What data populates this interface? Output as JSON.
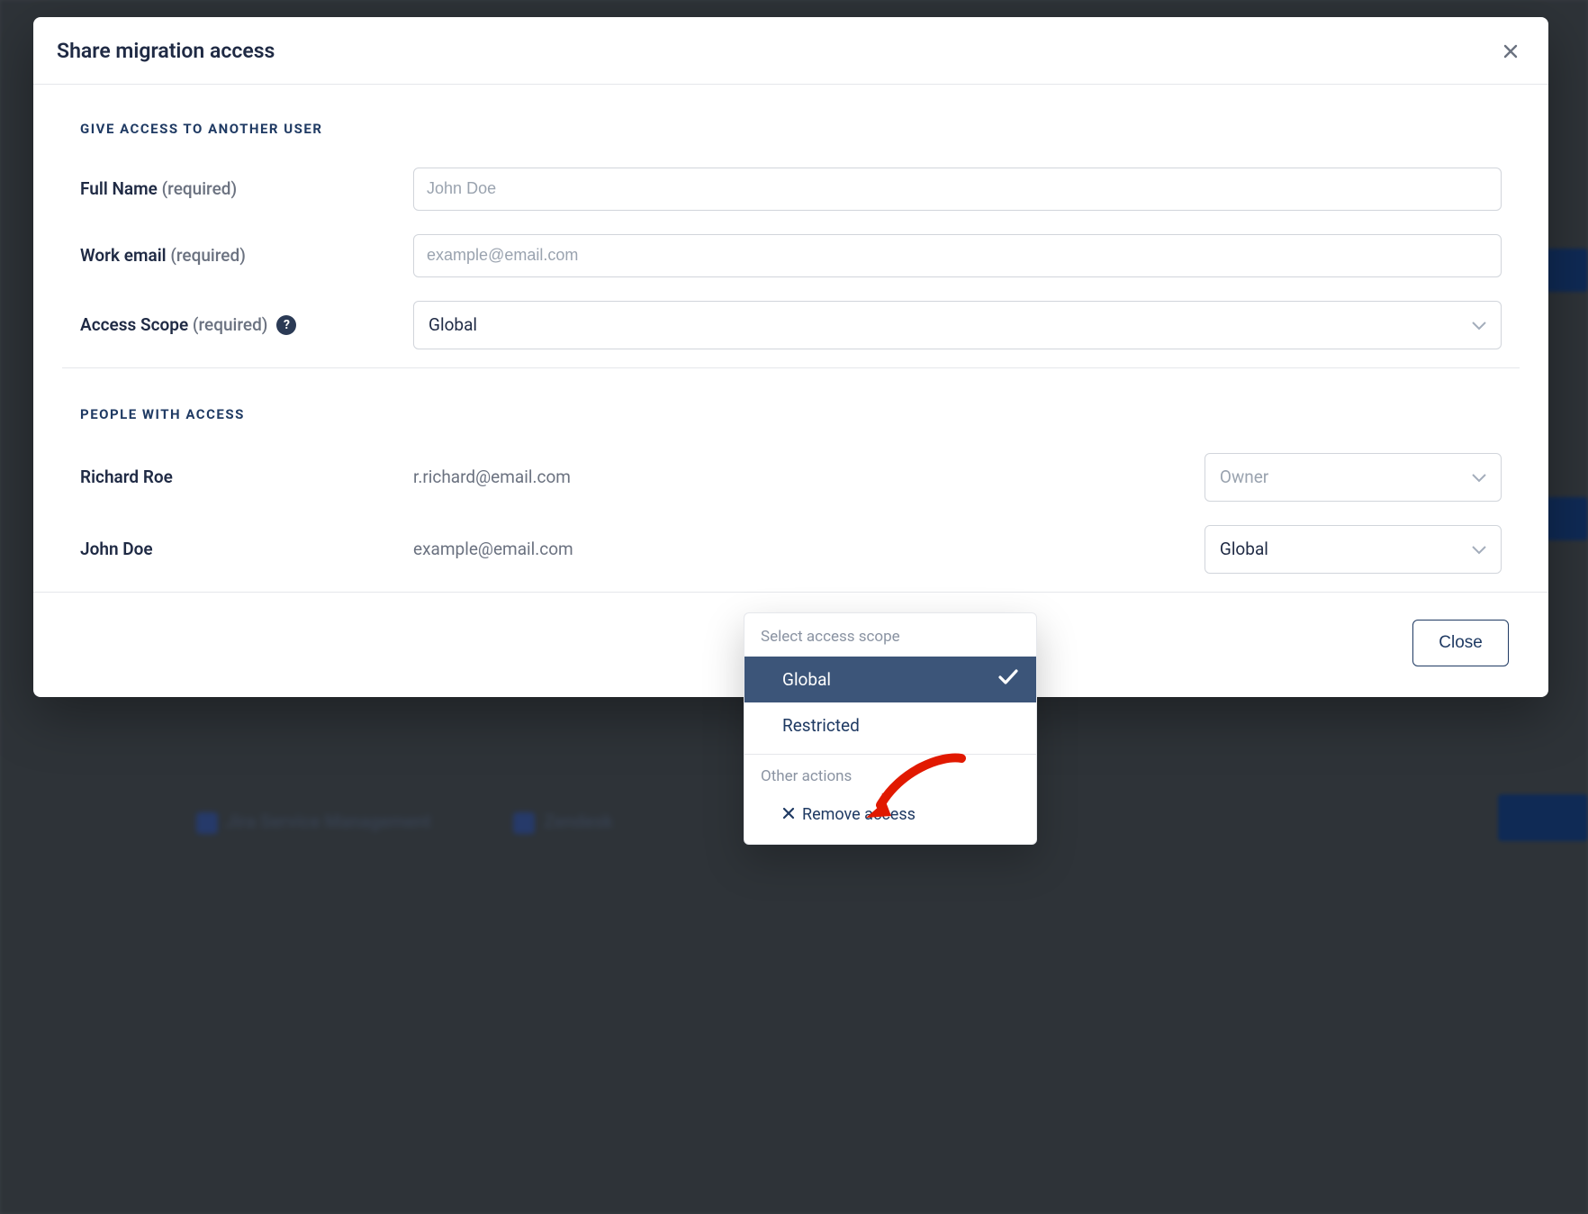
{
  "modal": {
    "title": "Share migration access",
    "section_give": "GIVE ACCESS TO ANOTHER USER",
    "full_name_label": "Full Name",
    "required_suffix": "(required)",
    "full_name_placeholder": "John Doe",
    "work_email_label": "Work email",
    "work_email_placeholder": "example@email.com",
    "access_scope_label": "Access Scope",
    "access_scope_value": "Global",
    "section_people": "PEOPLE WITH ACCESS",
    "people": [
      {
        "name": "Richard Roe",
        "email": "r.richard@email.com",
        "role": "Owner",
        "disabled": true
      },
      {
        "name": "John Doe",
        "email": "example@email.com",
        "role": "Global",
        "disabled": false
      }
    ],
    "footer_close": "Close"
  },
  "dropdown": {
    "group_scope": "Select access scope",
    "opt_global": "Global",
    "opt_restricted": "Restricted",
    "group_other": "Other actions",
    "action_remove": "Remove access"
  },
  "background": {
    "service1": "Jira Service Management",
    "service2": "Zendesk"
  }
}
